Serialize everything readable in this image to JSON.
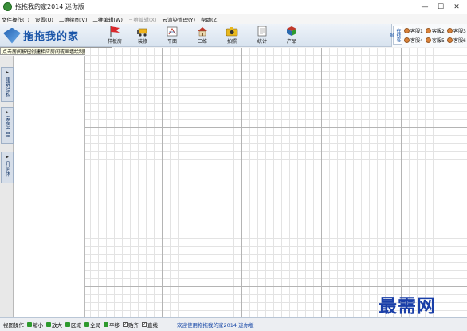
{
  "window": {
    "title": "拖拖我的家2014 迷你版"
  },
  "menu": [
    {
      "label": "文件操作(T)",
      "disabled": false
    },
    {
      "label": "设置(U)",
      "disabled": false
    },
    {
      "label": "二维绘图(V)",
      "disabled": false
    },
    {
      "label": "二维编辑(W)",
      "disabled": false
    },
    {
      "label": "三维编辑(X)",
      "disabled": true
    },
    {
      "label": "云渲染管理(Y)",
      "disabled": false
    },
    {
      "label": "帮助(Z)",
      "disabled": false
    }
  ],
  "logo": {
    "text": "拖拖我的家"
  },
  "toolbar": [
    {
      "label": "样板房",
      "icon": "flag-icon"
    },
    {
      "label": "装修",
      "icon": "bulldozer-icon"
    },
    {
      "label": "平面",
      "icon": "blueprint-icon"
    },
    {
      "label": "三维",
      "icon": "house-icon"
    },
    {
      "label": "拍照",
      "icon": "camera-icon"
    },
    {
      "label": "统计",
      "icon": "report-icon"
    },
    {
      "label": "产品",
      "icon": "product-icon"
    }
  ],
  "service": {
    "tab": "在线客服",
    "items": [
      "客服1",
      "客服2",
      "客服3",
      "客服4",
      "客服5",
      "客服6"
    ]
  },
  "hint": "点击房间按钮创建相应房间或画墙绘制任意户型",
  "sidebar": {
    "tabs": [
      "建筑结构",
      "家居产品",
      "几何体"
    ]
  },
  "status": {
    "label": "视图操作",
    "buttons": [
      {
        "label": "缩小",
        "color": "#2e9a2e"
      },
      {
        "label": "放大",
        "color": "#2e9a2e"
      },
      {
        "label": "区域",
        "color": "#2e9a2e"
      },
      {
        "label": "全局",
        "color": "#2e9a2e"
      },
      {
        "label": "平移",
        "color": "#2e9a2e"
      }
    ],
    "checks": [
      {
        "label": "贴齐",
        "checked": true
      },
      {
        "label": "直线",
        "checked": true
      }
    ],
    "welcome": "欢迎使用拖拖我的家2014 迷你版"
  },
  "watermark": "最需网"
}
